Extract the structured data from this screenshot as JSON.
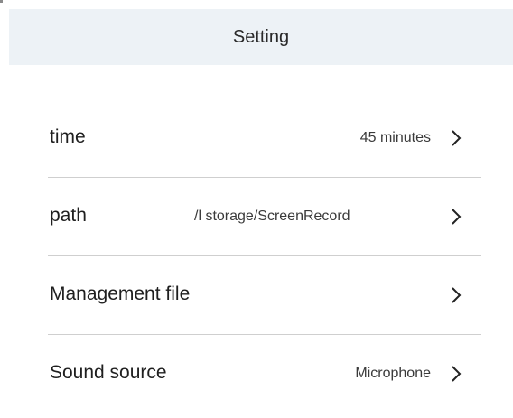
{
  "header": {
    "title": "Setting"
  },
  "settings": {
    "items": [
      {
        "label": "time",
        "value": "45 minutes"
      },
      {
        "label": "path",
        "value": "l storage/ScreenRecord/"
      },
      {
        "label": "Management file",
        "value": ""
      },
      {
        "label": "Sound source",
        "value": "Microphone"
      }
    ]
  },
  "icons": {
    "row_arrow": "chevron-right-icon"
  }
}
